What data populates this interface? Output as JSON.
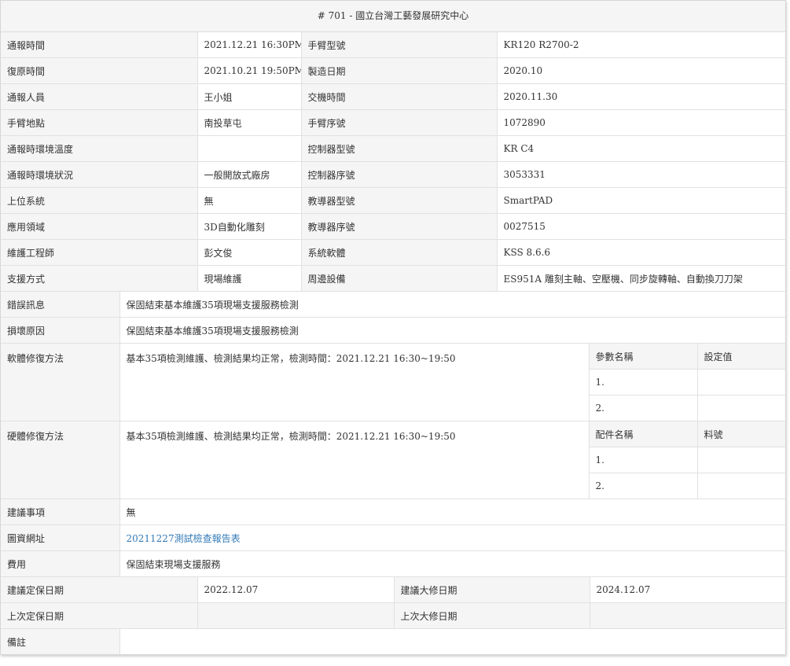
{
  "title": "# 701 - 國立台灣工藝發展研究中心",
  "info_rows": [
    {
      "label1": "通報時間",
      "value1": "2021.12.21 16:30PM",
      "label2": "手臂型號",
      "value2": "KR120 R2700-2"
    },
    {
      "label1": "復原時間",
      "value1": "2021.10.21 19:50PM",
      "label2": "製造日期",
      "value2": "2020.10"
    },
    {
      "label1": "通報人員",
      "value1": "王小姐",
      "label2": "交機時間",
      "value2": "2020.11.30"
    },
    {
      "label1": "手臂地點",
      "value1": "南投草屯",
      "label2": "手臂序號",
      "value2": "1072890"
    },
    {
      "label1": "通報時環境溫度",
      "value1": "",
      "label2": "控制器型號",
      "value2": "KR C4"
    },
    {
      "label1": "通報時環境狀況",
      "value1": "一般開放式廠房",
      "label2": "控制器序號",
      "value2": "3053331"
    },
    {
      "label1": "上位系統",
      "value1": "無",
      "label2": "教導器型號",
      "value2": "SmartPAD"
    },
    {
      "label1": "應用領域",
      "value1": "3D自動化雕刻",
      "label2": "教導器序號",
      "value2": "0027515"
    },
    {
      "label1": "維護工程師",
      "value1": "彭文俊",
      "label2": "系統軟體",
      "value2": "KSS 8.6.6"
    },
    {
      "label1": "支援方式",
      "value1": "現場維護",
      "label2": "周邊設備",
      "value2": "ES951A 雕刻主軸、空壓機、同步旋轉軸、自動換刀刀架"
    }
  ],
  "error_msg": {
    "label": "錯誤訊息",
    "value": "保固結束基本維護35項現場支援服務檢測"
  },
  "damage_cause": {
    "label": "損壞原因",
    "value": "保固結束基本維護35項現場支援服務檢測"
  },
  "software_fix": {
    "label": "軟體修復方法",
    "value": "基本35項檢測維護、檢測結果均正常，檢測時間：2021.12.21 16:30~19:50",
    "col1": "參數名稱",
    "col2": "設定值",
    "rows": [
      {
        "name": "1.",
        "val": ""
      },
      {
        "name": "2.",
        "val": ""
      }
    ]
  },
  "hardware_fix": {
    "label": "硬體修復方法",
    "value": "基本35項檢測維護、檢測結果均正常，檢測時間：2021.12.21 16:30~19:50",
    "col1": "配件名稱",
    "col2": "料號",
    "rows": [
      {
        "name": "1.",
        "val": ""
      },
      {
        "name": "2.",
        "val": ""
      }
    ]
  },
  "suggestion": {
    "label": "建議事項",
    "value": "無"
  },
  "data_url": {
    "label": "圖資網址",
    "value": "20211227測試檢查報告表"
  },
  "cost": {
    "label": "費用",
    "value": "保固結束現場支援服務"
  },
  "schedule": [
    {
      "label1": "建議定保日期",
      "value1": "2022.12.07",
      "label2": "建議大修日期",
      "value2": "2024.12.07"
    },
    {
      "label1": "上次定保日期",
      "value1": "",
      "label2": "上次大修日期",
      "value2": ""
    }
  ],
  "remark": {
    "label": "備註",
    "value": ""
  }
}
